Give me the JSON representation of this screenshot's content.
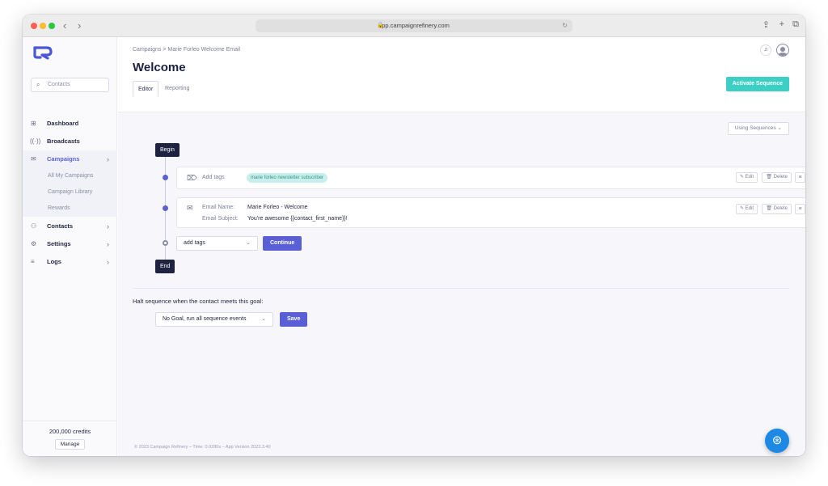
{
  "browser": {
    "url": "app.campaignrefinery.com"
  },
  "sidebar": {
    "search_placeholder": "Contacts",
    "items": [
      {
        "label": "Dashboard",
        "icon": "grid-icon"
      },
      {
        "label": "Broadcasts",
        "icon": "broadcast-icon"
      },
      {
        "label": "Campaigns",
        "icon": "inbox-icon"
      },
      {
        "label": "Contacts",
        "icon": "person-icon"
      },
      {
        "label": "Settings",
        "icon": "gear-icon"
      },
      {
        "label": "Logs",
        "icon": "list-icon"
      }
    ],
    "campaign_subitems": [
      "All My Campaigns",
      "Campaign Library",
      "Rewards"
    ],
    "credits": "200,000 credits",
    "manage_label": "Manage"
  },
  "header": {
    "breadcrumb": "Campaigns > Marie Forleo Welcome Email",
    "title": "Welcome",
    "tabs": [
      "Editor",
      "Reporting"
    ],
    "activate_label": "Activate Sequence",
    "brand_color": "#3ccfc6"
  },
  "sequence": {
    "mode_select": "Using Sequences",
    "begin_label": "Begin",
    "end_label": "End",
    "add_tags_step": {
      "label": "Add tags",
      "tag": "marie forleo newsletter subscriber"
    },
    "email_step": {
      "name_label": "Email Name:",
      "name_value": "Marie Forleo - Welcome",
      "subject_label": "Email Subject:",
      "subject_value": "You're awesome {{contact_first_name}}!"
    },
    "edit_label": "Edit",
    "delete_label": "Delete",
    "new_step_select": "add tags",
    "continue_label": "Continue"
  },
  "goal": {
    "label": "Halt sequence when the contact meets this goal:",
    "select_value": "No Goal, run all sequence events",
    "save_label": "Save"
  },
  "footer": "© 2023 Campaign Refinery – Time: 0.0280s – App Version 2023.3.40",
  "accent_color": "#5a5fd6"
}
